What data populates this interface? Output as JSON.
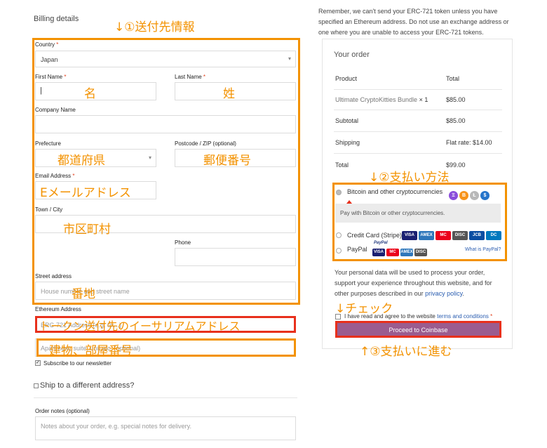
{
  "billing": {
    "heading": "Billing details",
    "country_label": "Country",
    "country_value": "Japan",
    "first_name_label": "First Name",
    "first_name_value": "|",
    "last_name_label": "Last Name",
    "company_label": "Company Name",
    "prefecture_label": "Prefecture",
    "postcode_label": "Postcode / ZIP (optional)",
    "email_label": "Email Address",
    "town_label": "Town / City",
    "phone_label": "Phone",
    "street_label": "Street address",
    "street_placeholder": "House number and street name",
    "eth_label": "Ethereum Address",
    "eth_placeholder": "ERC-721 Address (e.g. 0x...)",
    "apt_placeholder": "Apartment, suite, unit etc. (optional)",
    "newsletter_label": "Subscribe to our newsletter",
    "ship_different_label": "Ship to a different address?",
    "order_notes_label": "Order notes (optional)",
    "order_notes_placeholder": "Notes about your order, e.g. special notes for delivery.",
    "required_mark": "*"
  },
  "annotations": {
    "shipping_info": "↓①送付先情報",
    "first_name": "名",
    "last_name": "姓",
    "prefecture": "都道府県",
    "postcode": "郵便番号",
    "email": "Eメールアドレス",
    "city": "市区町村",
    "street": "番地",
    "eth_address": "トークン送付先のイーサリアムアドレス",
    "building": "建物、部屋番号",
    "payment_method": "↓②支払い方法",
    "check": "↓チェック",
    "proceed": "↑③支払いに進む"
  },
  "notice": "Remember, we can't send your ERC-721 token unless you have specified an Ethereum address. Do not use an exchange address or one where you are unable to access your ERC-721 tokens.",
  "order": {
    "heading": "Your order",
    "col_product": "Product",
    "col_total": "Total",
    "item_name": "Ultimate CryptoKitties Bundle",
    "item_qty": "× 1",
    "item_total": "$85.00",
    "subtotal_label": "Subtotal",
    "subtotal_value": "$85.00",
    "shipping_label": "Shipping",
    "shipping_value": "Flat rate: $14.00",
    "total_label": "Total",
    "total_value": "$99.00"
  },
  "payment": {
    "crypto_label": "Bitcoin and other cryptocurrencies",
    "crypto_desc": "Pay with Bitcoin or other cryptocurrencies.",
    "card_label": "Credit Card (Stripe)",
    "paypal_label": "PayPal",
    "what_is_paypal": "What is PayPal?",
    "paypal_small": "PayPal",
    "coins": [
      "Ξ",
      "B",
      "Ł",
      "$"
    ],
    "card_icons": [
      "VISA",
      "AMEX",
      "MC",
      "DISC",
      "JCB",
      "DC"
    ],
    "paypal_icons": [
      "VISA",
      "MC",
      "AMEX",
      "DISC"
    ]
  },
  "privacy": {
    "text": "Your personal data will be used to process your order, support your experience throughout this website, and for other purposes described in our",
    "link": "privacy policy",
    "end": "."
  },
  "terms": {
    "text": "I have read and agree to the website",
    "link": "terms and conditions",
    "mark": "*"
  },
  "proceed_button": "Proceed to Coinbase",
  "colors": {
    "annotation_orange": "#f39200",
    "annotation_red": "#e8301c",
    "button_purple": "#9b5c8f",
    "link_blue": "#2a5db0"
  }
}
